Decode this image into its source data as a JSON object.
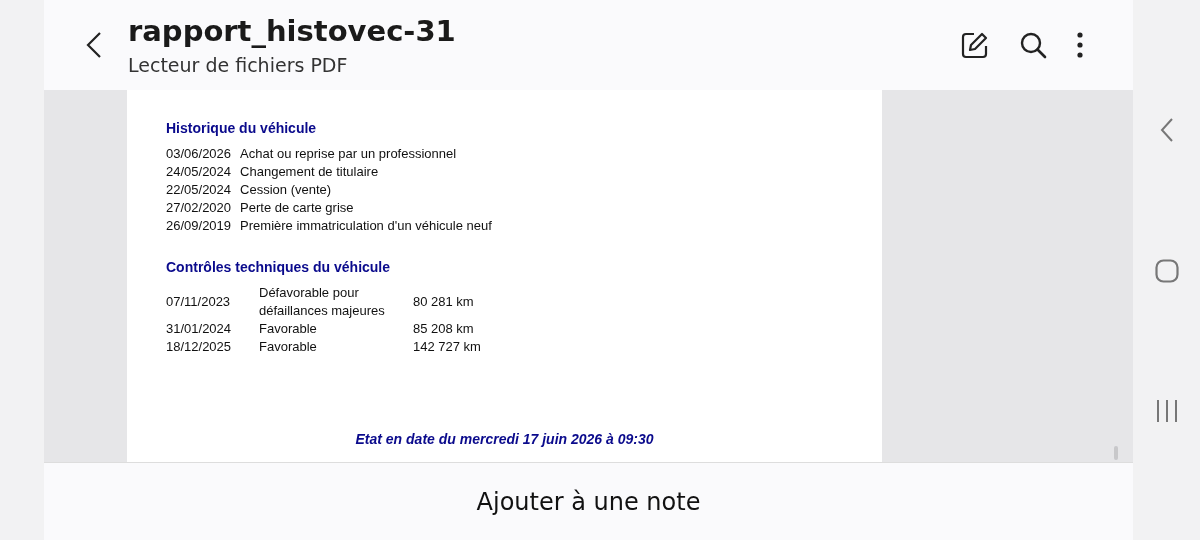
{
  "header": {
    "title": "rapport_histovec-31",
    "subtitle": "Lecteur de fichiers PDF"
  },
  "document": {
    "history": {
      "heading": "Historique du véhicule",
      "rows": [
        {
          "date": "03/06/2026",
          "event": "Achat ou reprise par un professionnel"
        },
        {
          "date": "24/05/2024",
          "event": "Changement de titulaire"
        },
        {
          "date": "22/05/2024",
          "event": "Cession (vente)"
        },
        {
          "date": "27/02/2020",
          "event": "Perte de carte grise"
        },
        {
          "date": "26/09/2019",
          "event": "Première immatriculation d'un véhicule neuf"
        }
      ]
    },
    "inspections": {
      "heading": "Contrôles techniques du véhicule",
      "rows": [
        {
          "date": "07/11/2023",
          "result": "Défavorable pour défaillances majeures",
          "mileage": "80 281 km"
        },
        {
          "date": "31/01/2024",
          "result": "Favorable",
          "mileage": "85 208 km"
        },
        {
          "date": "18/12/2025",
          "result": "Favorable",
          "mileage": "142 727 km"
        }
      ]
    },
    "footer": "Etat en date du mercredi 17 juin 2026 à 09:30"
  },
  "bottom_bar": {
    "action": "Ajouter à une note"
  }
}
